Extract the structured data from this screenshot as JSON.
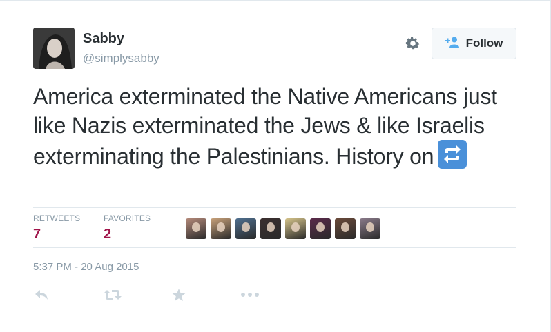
{
  "author": {
    "name": "Sabby",
    "handle": "@simplysabby"
  },
  "follow_button": {
    "label": "Follow"
  },
  "tweet": {
    "text": "America exterminated the Native Americans just like Nazis exterminated the Jews & like Israelis exterminating the Palestinians. History on",
    "emoji": "retweet-emoji"
  },
  "stats": {
    "retweets_label": "RETWEETS",
    "retweets_value": "7",
    "favorites_label": "FAVORITES",
    "favorites_value": "2"
  },
  "favoriters": [
    {
      "name": "favoriter-1",
      "color": "#b58a7a"
    },
    {
      "name": "favoriter-2",
      "color": "#c9a27a"
    },
    {
      "name": "favoriter-3",
      "color": "#4f6f8f"
    },
    {
      "name": "favoriter-4",
      "color": "#3b2f2f"
    },
    {
      "name": "favoriter-5",
      "color": "#d6c48a"
    },
    {
      "name": "favoriter-6",
      "color": "#5a2a4a"
    },
    {
      "name": "favoriter-7",
      "color": "#6a4a3a"
    },
    {
      "name": "favoriter-8",
      "color": "#8a7a8a"
    }
  ],
  "timestamp": "5:37 PM - 20 Aug 2015",
  "actions": [
    "reply-icon",
    "retweet-icon",
    "favorite-icon",
    "more-icon"
  ],
  "colors": {
    "text": "#292f33",
    "muted": "#8899a6",
    "stat_value": "#a0144a",
    "follow_accent": "#55acee",
    "action_icon": "#ccd6dd",
    "emoji_bg": "#4a90d9"
  }
}
